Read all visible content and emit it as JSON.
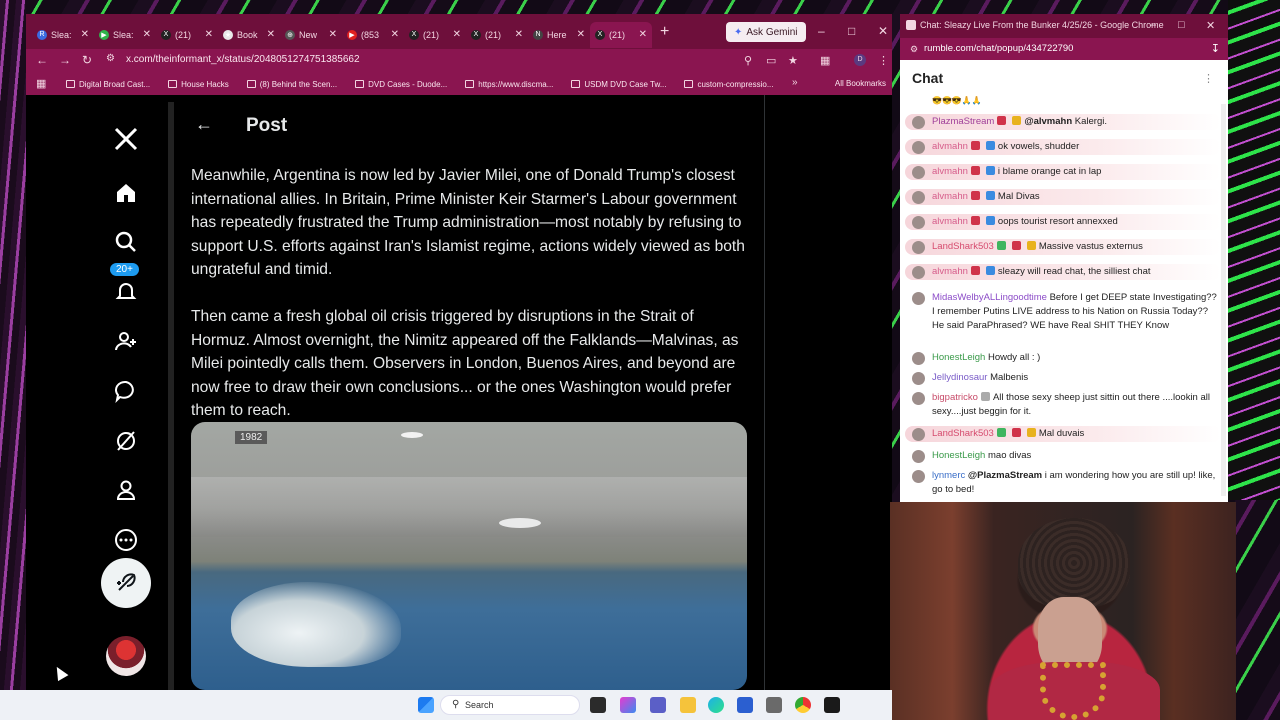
{
  "browser": {
    "tabs": [
      {
        "label": "Slea:",
        "icon": "R",
        "color": "#3b6be0",
        "active": false
      },
      {
        "label": "Slea:",
        "icon": "▶",
        "color": "#2fb34a",
        "active": false
      },
      {
        "label": "(21)",
        "icon": "X",
        "color": "#222",
        "active": false
      },
      {
        "label": "Book",
        "icon": "★",
        "color": "#e8e8e8",
        "active": false
      },
      {
        "label": "New",
        "icon": "⊕",
        "color": "#555",
        "active": false
      },
      {
        "label": "(853",
        "icon": "▶",
        "color": "#e02020",
        "active": false
      },
      {
        "label": "(21)",
        "icon": "X",
        "color": "#222",
        "active": false
      },
      {
        "label": "(21)",
        "icon": "X",
        "color": "#222",
        "active": false
      },
      {
        "label": "Here",
        "icon": "N",
        "color": "#444",
        "active": false
      },
      {
        "label": "(21)",
        "icon": "X",
        "color": "#222",
        "active": true
      }
    ],
    "gemini_label": "Ask Gemini",
    "url": "x.com/theinformant_x/status/2048051274751385662",
    "bookmarks": [
      "Digital Broad Cast...",
      "House Hacks",
      "(8) Behind the Scen...",
      "DVD Cases - Duode...",
      "https://www.discma...",
      "USDM DVD Case Tw...",
      "custom-compressio..."
    ],
    "all_bookmarks": "All Bookmarks"
  },
  "x": {
    "page_title": "Post",
    "notif_badge": "20+",
    "paragraph1": "Meanwhile, Argentina is now led by Javier Milei, one of Donald Trump's closest international allies. In Britain, Prime Minister Keir Starmer's Labour government has repeatedly frustrated the Trump administration—most notably by refusing to support U.S. efforts against Iran's Islamist regime, actions widely viewed as both ungrateful and timid.",
    "paragraph2": "Then came a fresh global oil crisis triggered by disruptions in the Strait of Hormuz. Almost overnight, the Nimitz appeared off the Falklands—Malvinas, as Milei pointedly calls them. Observers in London, Buenos Aires, and beyond are now free to draw their own conclusions... or the ones Washington would prefer them to reach.",
    "video_label": "1982"
  },
  "chat": {
    "window_title": "Chat: Sleazy Live From the Bunker 4/25/26 - Google Chrome",
    "url": "rumble.com/chat/popup/434722790",
    "heading": "Chat",
    "messages": [
      {
        "user": "PlazmaStream",
        "color": "#a0409a",
        "badges": [
          "red",
          "gold"
        ],
        "mention": "@alvmahn",
        "text": " Kalergi.",
        "hl": true
      },
      {
        "user": "alvmahn",
        "color": "#d65c8a",
        "badges": [
          "red",
          "blue"
        ],
        "mention": "",
        "text": "ok vowels, shudder",
        "hl": true
      },
      {
        "user": "alvmahn",
        "color": "#d65c8a",
        "badges": [
          "red",
          "blue"
        ],
        "mention": "",
        "text": "i blame orange cat in lap",
        "hl": true
      },
      {
        "user": "alvmahn",
        "color": "#d65c8a",
        "badges": [
          "red",
          "blue"
        ],
        "mention": "",
        "text": "Mal Divas",
        "hl": true
      },
      {
        "user": "alvmahn",
        "color": "#d65c8a",
        "badges": [
          "red",
          "blue"
        ],
        "mention": "",
        "text": "oops tourist resort annexxed",
        "hl": true
      },
      {
        "user": "LandShark503",
        "color": "#d64b6e",
        "badges": [
          "green",
          "red",
          "gold"
        ],
        "mention": "",
        "text": "Massive vastus externus",
        "hl": true
      },
      {
        "user": "alvmahn",
        "color": "#d65c8a",
        "badges": [
          "red",
          "blue"
        ],
        "mention": "",
        "text": "sleazy will read chat, the silliest chat",
        "hl": true
      },
      {
        "user": "MidasWelbyALLingoodtime",
        "color": "#8c4cc8",
        "badges": [],
        "mention": "",
        "text": "Before I get DEEP state Investigating?? I remember Putins LIVE address to his Nation on Russia Today?? He said ParaPhrased? WE have Real SHIT THEY Know",
        "hl": false
      },
      {
        "user": "HonestLeigh",
        "color": "#3a9a4a",
        "badges": [],
        "mention": "",
        "text": "Howdy all : )",
        "hl": false
      },
      {
        "user": "Jellydinosaur",
        "color": "#7a5cc8",
        "badges": [],
        "mention": "",
        "text": "Malbenis",
        "hl": false
      },
      {
        "user": "bigpatricko",
        "color": "#c84c6a",
        "badges": [
          "grey"
        ],
        "mention": "",
        "text": "All those sexy sheep just sittin out there ....lookin all sexy....just beggin for it.",
        "hl": false
      },
      {
        "user": "LandShark503",
        "color": "#d64b6e",
        "badges": [
          "green",
          "red",
          "gold"
        ],
        "mention": "",
        "text": "Mal duvais",
        "hl": true
      },
      {
        "user": "HonestLeigh",
        "color": "#3a9a4a",
        "badges": [],
        "mention": "",
        "text": "mao divas",
        "hl": false
      },
      {
        "user": "lynmerc",
        "color": "#3a6ec8",
        "badges": [],
        "mention": "@PlazmaStream",
        "text": " i am wondering how you are still up! like, go to bed!",
        "hl": false
      }
    ]
  },
  "taskbar": {
    "search_label": "Search"
  }
}
